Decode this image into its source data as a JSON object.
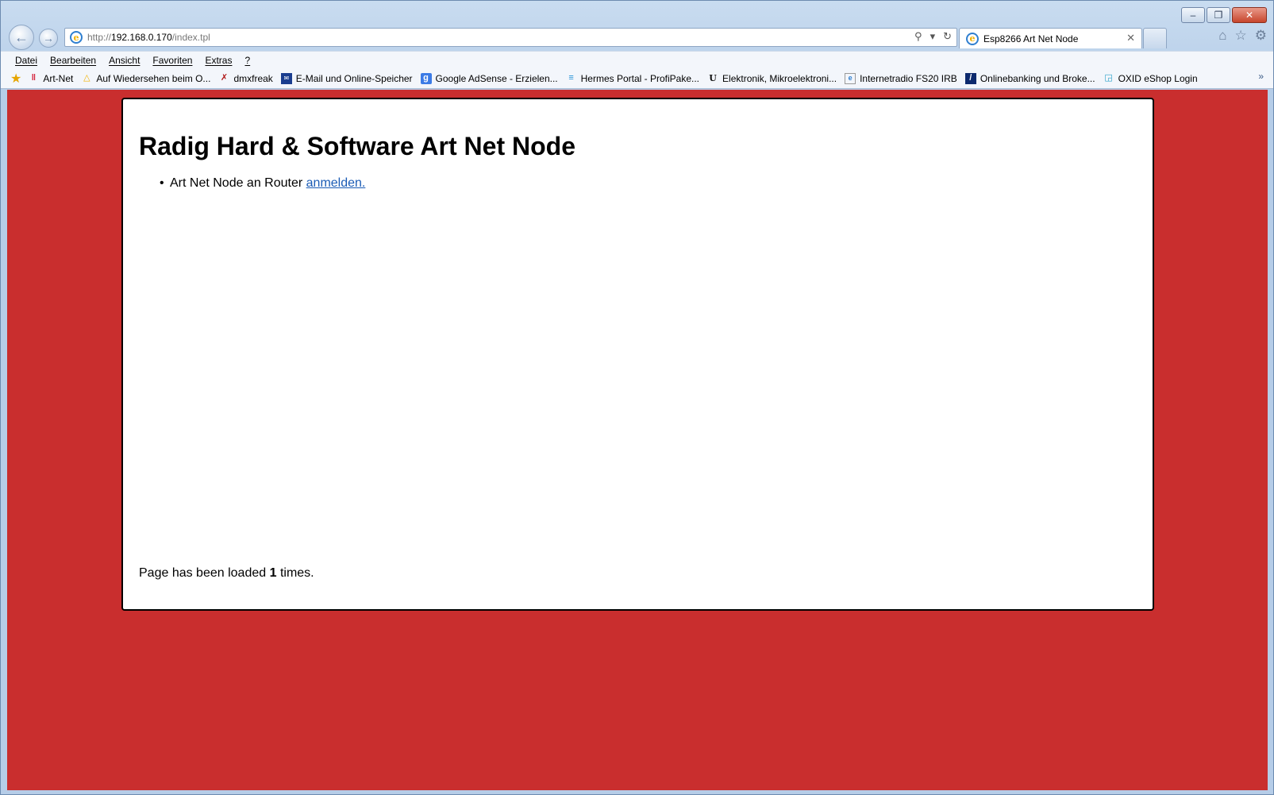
{
  "browser": {
    "address": {
      "prefix": "http://",
      "host": "192.168.0.170",
      "path": "/index.tpl"
    },
    "tab_title": "Esp8266 Art Net Node",
    "menu": [
      "Datei",
      "Bearbeiten",
      "Ansicht",
      "Favoriten",
      "Extras",
      "?"
    ],
    "favorites": [
      {
        "label": "Art-Net",
        "icon": "art-net-icon",
        "color": "#d4213a"
      },
      {
        "label": "Auf Wiedersehen beim O...",
        "icon": "drive-icon",
        "color": "#f2b200"
      },
      {
        "label": "dmxfreak",
        "icon": "x-icon",
        "color": "#b01919"
      },
      {
        "label": "E-Mail und Online-Speicher",
        "icon": "mail-icon",
        "color": "#1a3d8f"
      },
      {
        "label": "Google AdSense - Erzielen...",
        "icon": "google-icon",
        "color": "#3b7be6"
      },
      {
        "label": "Hermes Portal - ProfiPake...",
        "icon": "hermes-icon",
        "color": "#1f8fd6"
      },
      {
        "label": "Elektronik, Mikroelektroni...",
        "icon": "ur-icon",
        "color": "#111111"
      },
      {
        "label": "Internetradio FS20 IRB",
        "icon": "ie-page-icon",
        "color": "#2f7fd0"
      },
      {
        "label": "Onlinebanking und Broke...",
        "icon": "bank-icon",
        "color": "#0d2a6e"
      },
      {
        "label": "OXID eShop Login",
        "icon": "cart-icon",
        "color": "#2aa1c9"
      }
    ]
  },
  "page": {
    "background_color": "#c92e2e",
    "title": "Radig Hard & Software Art Net Node",
    "list_item_text": "Art Net Node an Router ",
    "list_item_link": "anmelden.",
    "footer_prefix": "Page has been loaded ",
    "footer_count": "1",
    "footer_suffix": " times."
  }
}
